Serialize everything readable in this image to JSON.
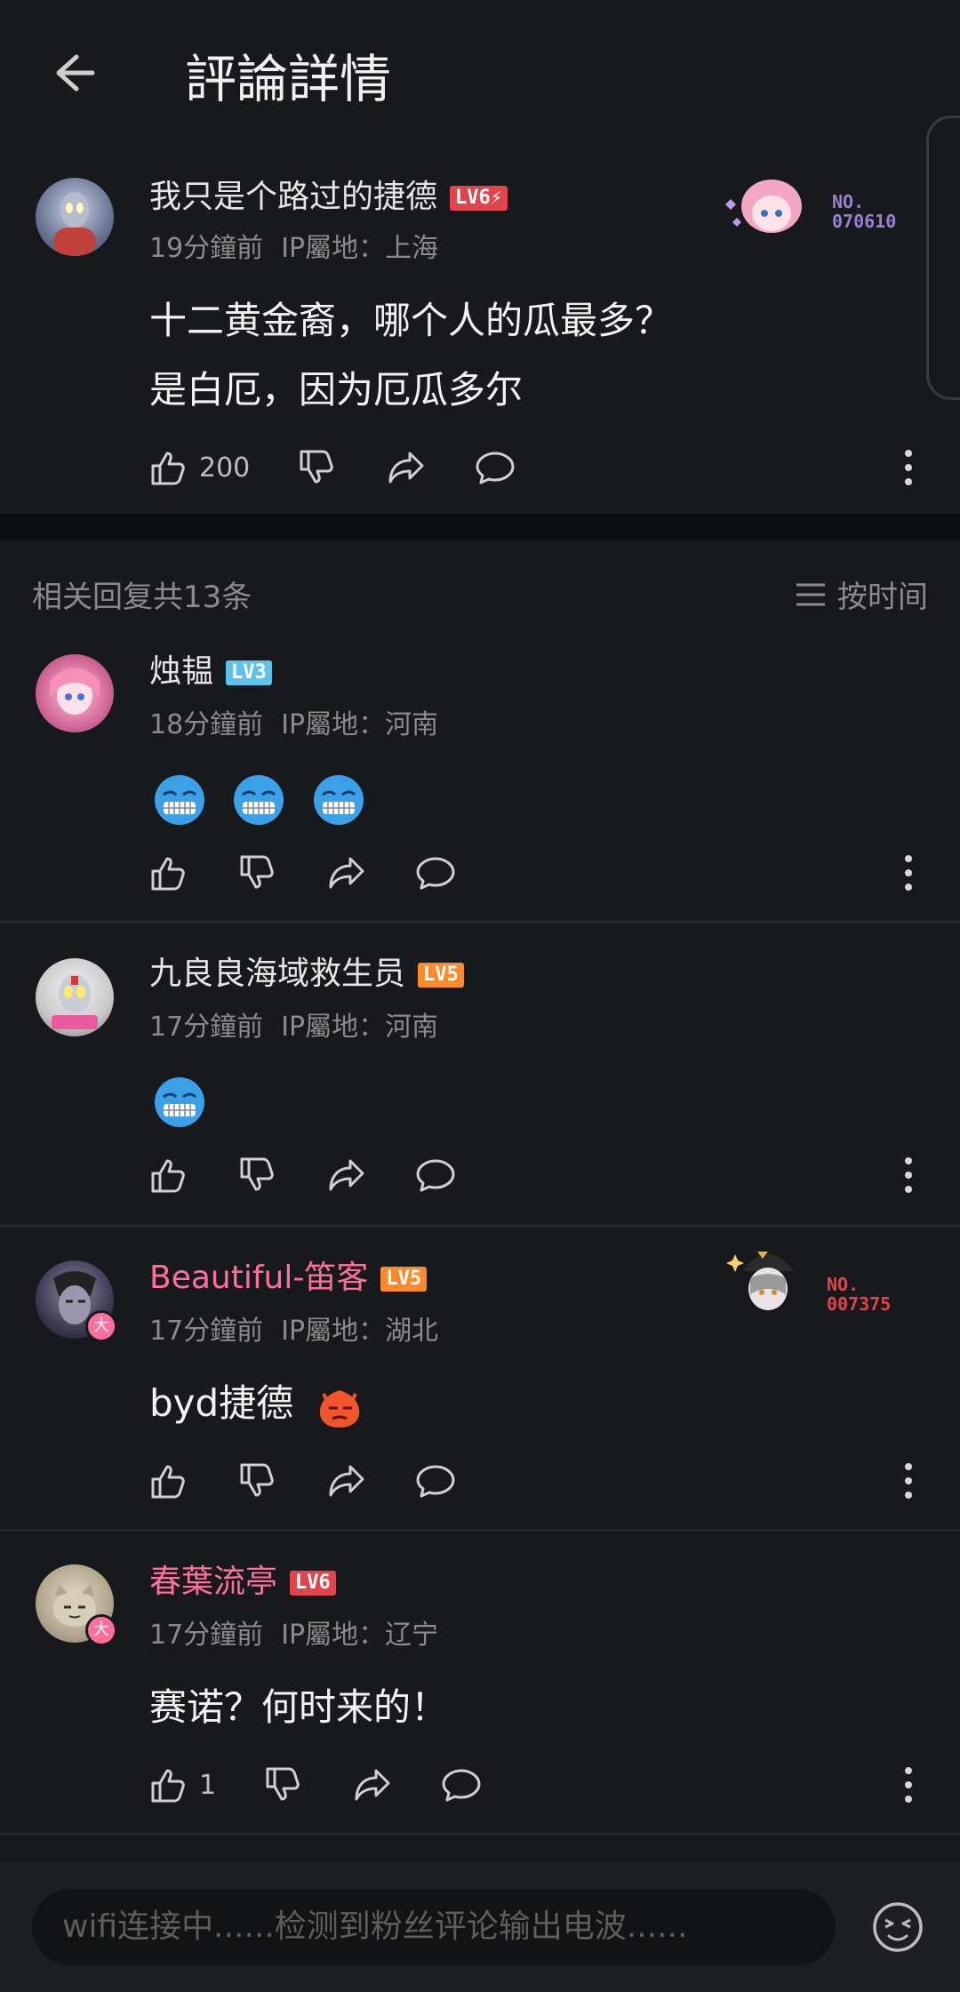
{
  "header": {
    "title": "評論詳情"
  },
  "main_comment": {
    "name": "我只是个路过的捷德",
    "level": "LV6⚡",
    "time": "19分鐘前",
    "ip": "IP屬地：上海",
    "lines": [
      "十二黄金裔，哪个人的瓜最多？",
      "是白厄，因为厄瓜多尔"
    ],
    "likes": "200",
    "badge_no": "NO.\n070610"
  },
  "related": {
    "title": "相关回复共13条",
    "sort_label": "按时间"
  },
  "replies": [
    {
      "name": "烛韫",
      "level": "LV3",
      "time": "18分鐘前",
      "ip": "IP屬地：河南",
      "text": "",
      "likes": ""
    },
    {
      "name": "九良良海域救生员",
      "level": "LV5",
      "time": "17分鐘前",
      "ip": "IP屬地：河南",
      "text": "",
      "likes": ""
    },
    {
      "name": "Beautiful-笛客",
      "level": "LV5",
      "time": "17分鐘前",
      "ip": "IP屬地：湖北",
      "text": "byd捷德",
      "likes": "",
      "badge_no": "NO.\n007375",
      "avatar_tag": "大"
    },
    {
      "name": "春葉流亭",
      "level": "LV6",
      "time": "17分鐘前",
      "ip": "IP屬地：辽宁",
      "text": "赛诺？何时来的！",
      "likes": "1",
      "avatar_tag": "大"
    }
  ],
  "input": {
    "placeholder": "wifi连接中......检测到粉丝评论输出电波......"
  },
  "colors": {
    "bg": "#18191c",
    "lv6": "#e0454b",
    "lv3": "#5ec3ea",
    "lv5": "#ff8a2b",
    "pink": "#ff6f9b",
    "badge_purple": "#9b7fd1"
  }
}
